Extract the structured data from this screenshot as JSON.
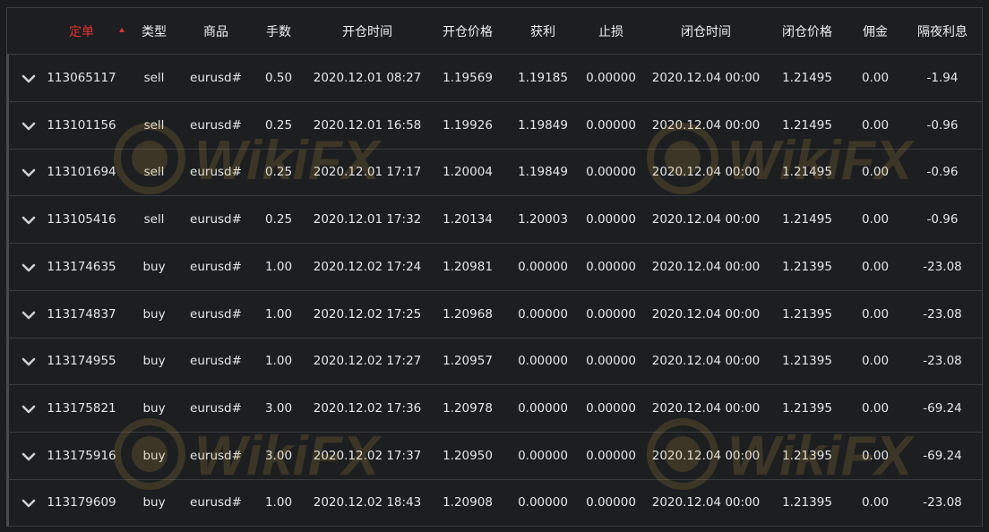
{
  "header": {
    "columns": [
      "定单",
      "类型",
      "商品",
      "手数",
      "开仓时间",
      "开仓价格",
      "获利",
      "止损",
      "闭仓时间",
      "闭仓价格",
      "佣金",
      "隔夜利息"
    ],
    "sort_icon": "sort-up-icon",
    "active_color": "#e03131"
  },
  "rows": [
    [
      "113065117",
      "sell",
      "eurusd#",
      "0.50",
      "2020.12.01 08:27",
      "1.19569",
      "1.19185",
      "0.00000",
      "2020.12.04 00:00",
      "1.21495",
      "0.00",
      "-1.94"
    ],
    [
      "113101156",
      "sell",
      "eurusd#",
      "0.25",
      "2020.12.01 16:58",
      "1.19926",
      "1.19849",
      "0.00000",
      "2020.12.04 00:00",
      "1.21495",
      "0.00",
      "-0.96"
    ],
    [
      "113101694",
      "sell",
      "eurusd#",
      "0.25",
      "2020.12.01 17:17",
      "1.20004",
      "1.19849",
      "0.00000",
      "2020.12.04 00:00",
      "1.21495",
      "0.00",
      "-0.96"
    ],
    [
      "113105416",
      "sell",
      "eurusd#",
      "0.25",
      "2020.12.01 17:32",
      "1.20134",
      "1.20003",
      "0.00000",
      "2020.12.04 00:00",
      "1.21495",
      "0.00",
      "-0.96"
    ],
    [
      "113174635",
      "buy",
      "eurusd#",
      "1.00",
      "2020.12.02 17:24",
      "1.20981",
      "0.00000",
      "0.00000",
      "2020.12.04 00:00",
      "1.21395",
      "0.00",
      "-23.08"
    ],
    [
      "113174837",
      "buy",
      "eurusd#",
      "1.00",
      "2020.12.02 17:25",
      "1.20968",
      "0.00000",
      "0.00000",
      "2020.12.04 00:00",
      "1.21395",
      "0.00",
      "-23.08"
    ],
    [
      "113174955",
      "buy",
      "eurusd#",
      "1.00",
      "2020.12.02 17:27",
      "1.20957",
      "0.00000",
      "0.00000",
      "2020.12.04 00:00",
      "1.21395",
      "0.00",
      "-23.08"
    ],
    [
      "113175821",
      "buy",
      "eurusd#",
      "3.00",
      "2020.12.02 17:36",
      "1.20978",
      "0.00000",
      "0.00000",
      "2020.12.04 00:00",
      "1.21395",
      "0.00",
      "-69.24"
    ],
    [
      "113175916",
      "buy",
      "eurusd#",
      "3.00",
      "2020.12.02 17:37",
      "1.20950",
      "0.00000",
      "0.00000",
      "2020.12.04 00:00",
      "1.21395",
      "0.00",
      "-69.24"
    ],
    [
      "113179609",
      "buy",
      "eurusd#",
      "1.00",
      "2020.12.02 18:43",
      "1.20908",
      "0.00000",
      "0.00000",
      "2020.12.04 00:00",
      "1.21395",
      "0.00",
      "-23.08"
    ]
  ],
  "row_icon": "chevron-down-icon",
  "watermark": {
    "text": "WikiFX",
    "icon": "wikifx-logo-icon"
  }
}
